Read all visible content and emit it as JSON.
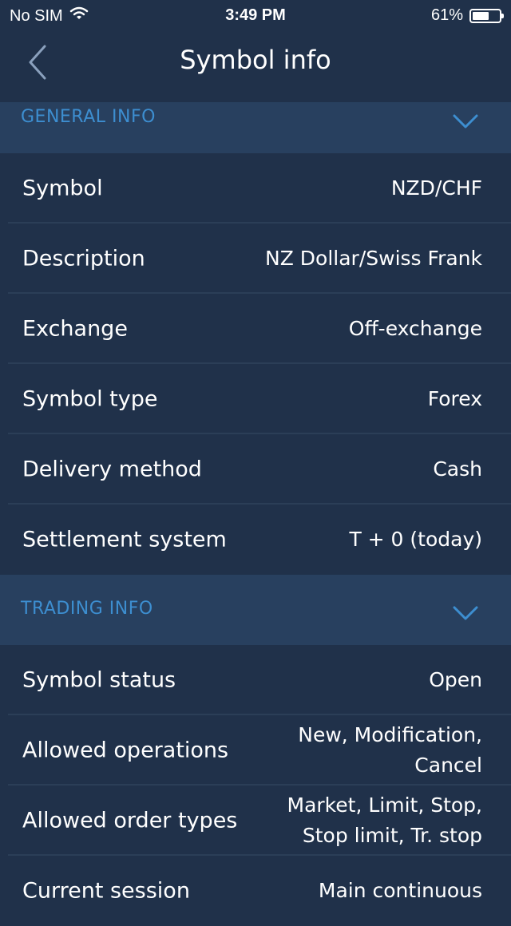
{
  "status_bar": {
    "carrier": "No SIM",
    "time": "3:49 PM",
    "battery": "61%",
    "battery_level": 0.61
  },
  "nav": {
    "title": "Symbol info"
  },
  "sections": {
    "general": {
      "title": "GENERAL INFO",
      "rows": [
        {
          "label": "Symbol",
          "value": "NZD/CHF"
        },
        {
          "label": "Description",
          "value": "NZ Dollar/Swiss Frank"
        },
        {
          "label": "Exchange",
          "value": "Off-exchange"
        },
        {
          "label": "Symbol type",
          "value": "Forex"
        },
        {
          "label": "Delivery method",
          "value": "Cash"
        },
        {
          "label": "Settlement system",
          "value": "T + 0 (today)"
        }
      ]
    },
    "trading": {
      "title": "TRADING INFO",
      "rows": [
        {
          "label": "Symbol status",
          "value": "Open"
        },
        {
          "label": "Allowed operations",
          "value": "New, Modification,\nCancel"
        },
        {
          "label": "Allowed order types",
          "value": "Market, Limit, Stop,\nStop limit, Tr. stop"
        },
        {
          "label": "Current session",
          "value": "Main continuous"
        }
      ]
    }
  },
  "colors": {
    "background": "#20314a",
    "section_header": "#28405f",
    "accent": "#3d8ed0",
    "divider": "#2b3e57"
  }
}
